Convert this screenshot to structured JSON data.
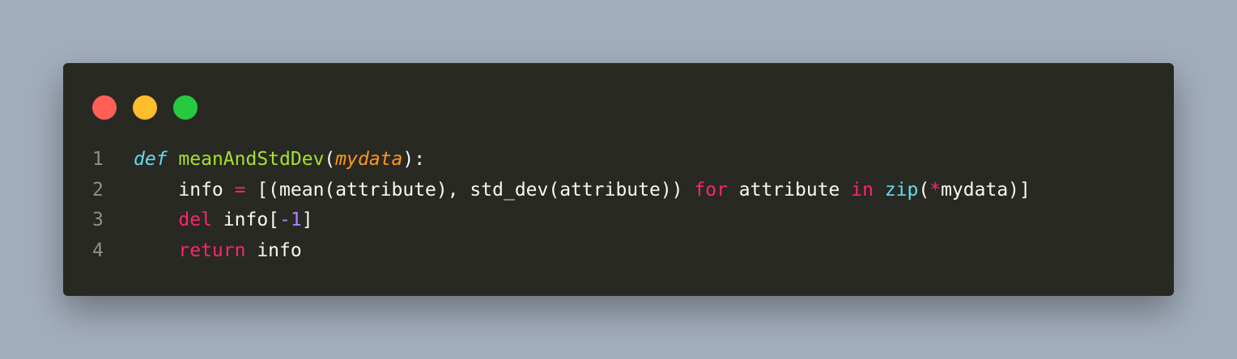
{
  "window": {
    "controls": [
      "close",
      "minimize",
      "maximize"
    ],
    "colors": {
      "background": "#282923",
      "page_background": "#a3aebd",
      "close": "#ff5f56",
      "minimize": "#ffbd2e",
      "maximize": "#27c93f"
    }
  },
  "code": {
    "language": "python",
    "lines": [
      {
        "number": "1",
        "tokens": [
          {
            "text": "def",
            "kind": "kw-def"
          },
          {
            "text": " ",
            "kind": "plain"
          },
          {
            "text": "meanAndStdDev",
            "kind": "fn"
          },
          {
            "text": "(",
            "kind": "plain"
          },
          {
            "text": "mydata",
            "kind": "param"
          },
          {
            "text": "):",
            "kind": "plain"
          }
        ]
      },
      {
        "number": "2",
        "tokens": [
          {
            "text": "    info ",
            "kind": "plain"
          },
          {
            "text": "=",
            "kind": "kw"
          },
          {
            "text": " [(mean(attribute), std_dev(attribute)) ",
            "kind": "plain"
          },
          {
            "text": "for",
            "kind": "kw"
          },
          {
            "text": " attribute ",
            "kind": "plain"
          },
          {
            "text": "in",
            "kind": "kw"
          },
          {
            "text": " ",
            "kind": "plain"
          },
          {
            "text": "zip",
            "kind": "builtin"
          },
          {
            "text": "(",
            "kind": "plain"
          },
          {
            "text": "*",
            "kind": "kw"
          },
          {
            "text": "mydata)]",
            "kind": "plain"
          }
        ]
      },
      {
        "number": "3",
        "tokens": [
          {
            "text": "    ",
            "kind": "plain"
          },
          {
            "text": "del",
            "kind": "kw"
          },
          {
            "text": " info[",
            "kind": "plain"
          },
          {
            "text": "-1",
            "kind": "num"
          },
          {
            "text": "]",
            "kind": "plain"
          }
        ]
      },
      {
        "number": "4",
        "tokens": [
          {
            "text": "    ",
            "kind": "plain"
          },
          {
            "text": "return",
            "kind": "kw"
          },
          {
            "text": " info",
            "kind": "plain"
          }
        ]
      }
    ]
  }
}
